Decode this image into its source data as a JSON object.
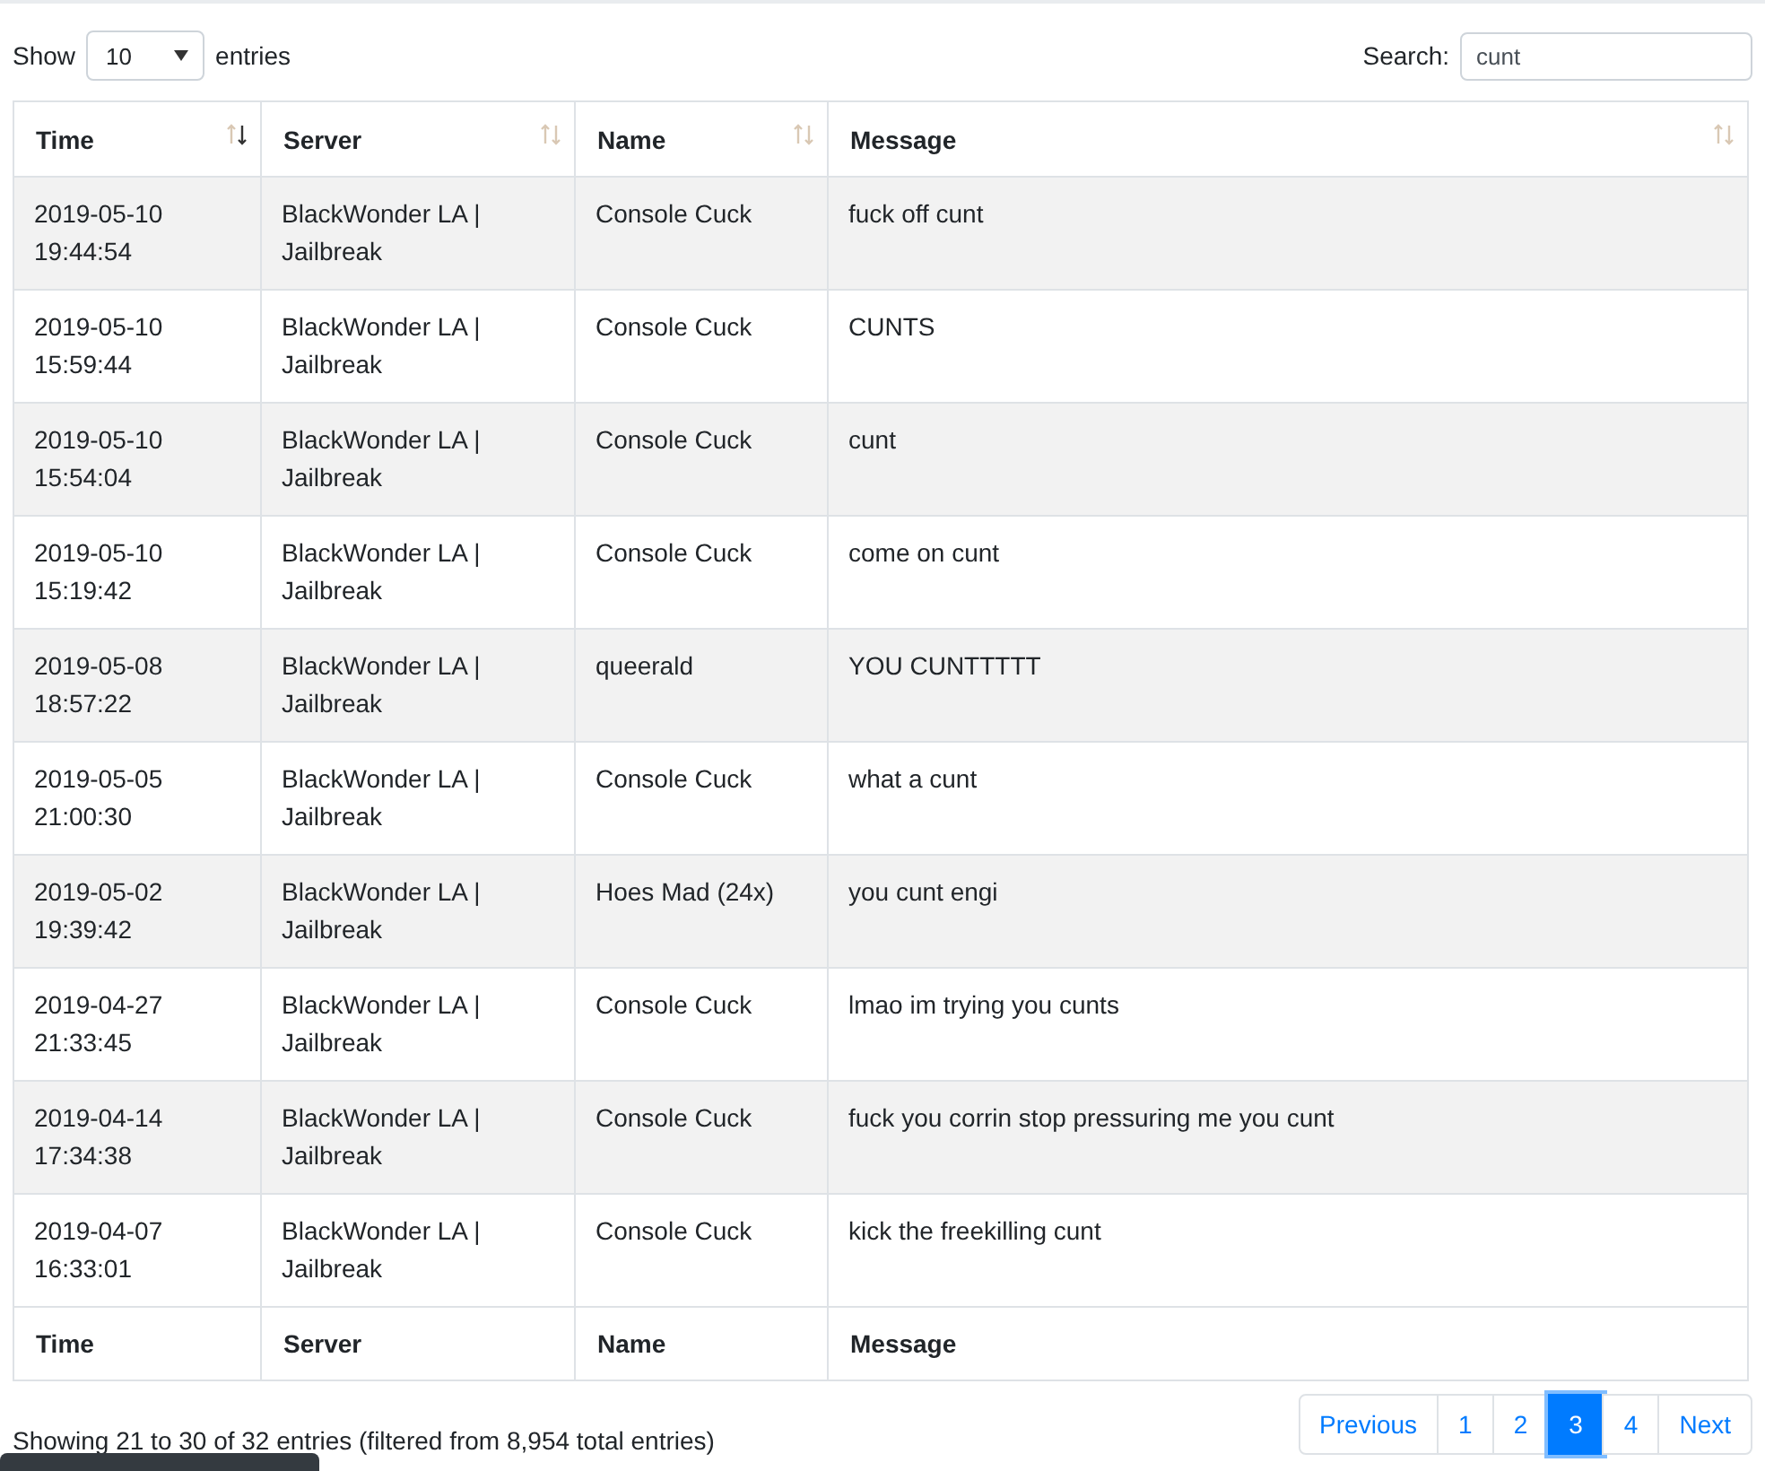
{
  "length_control": {
    "label_before": "Show",
    "value": "10",
    "label_after": "entries"
  },
  "search": {
    "label": "Search:",
    "value": "cunt"
  },
  "table": {
    "columns": [
      {
        "label": "Time",
        "sorted_descending": true
      },
      {
        "label": "Server",
        "sorted_descending": false
      },
      {
        "label": "Name",
        "sorted_descending": false
      },
      {
        "label": "Message",
        "sorted_descending": false
      }
    ],
    "rows": [
      {
        "time": "2019-05-10 19:44:54",
        "server": "BlackWonder LA | Jailbreak",
        "name": "Console Cuck",
        "message": "fuck off cunt"
      },
      {
        "time": "2019-05-10 15:59:44",
        "server": "BlackWonder LA | Jailbreak",
        "name": "Console Cuck",
        "message": "CUNTS"
      },
      {
        "time": "2019-05-10 15:54:04",
        "server": "BlackWonder LA | Jailbreak",
        "name": "Console Cuck",
        "message": "cunt"
      },
      {
        "time": "2019-05-10 15:19:42",
        "server": "BlackWonder LA | Jailbreak",
        "name": "Console Cuck",
        "message": "come on cunt"
      },
      {
        "time": "2019-05-08 18:57:22",
        "server": "BlackWonder LA | Jailbreak",
        "name": "queerald",
        "message": "YOU CUNTTTTT"
      },
      {
        "time": "2019-05-05 21:00:30",
        "server": "BlackWonder LA | Jailbreak",
        "name": "Console Cuck",
        "message": "what a cunt"
      },
      {
        "time": "2019-05-02 19:39:42",
        "server": "BlackWonder LA | Jailbreak",
        "name": "Hoes Mad (24x)",
        "message": "you cunt engi"
      },
      {
        "time": "2019-04-27 21:33:45",
        "server": "BlackWonder LA | Jailbreak",
        "name": "Console Cuck",
        "message": "lmao im trying you cunts"
      },
      {
        "time": "2019-04-14 17:34:38",
        "server": "BlackWonder LA | Jailbreak",
        "name": "Console Cuck",
        "message": "fuck you corrin stop pressuring me you cunt"
      },
      {
        "time": "2019-04-07 16:33:01",
        "server": "BlackWonder LA | Jailbreak",
        "name": "Console Cuck",
        "message": "kick the freekilling cunt"
      }
    ],
    "footer_columns": [
      "Time",
      "Server",
      "Name",
      "Message"
    ]
  },
  "info": "Showing 21 to 30 of 32 entries (filtered from 8,954 total entries)",
  "pagination": [
    {
      "label": "Previous",
      "selected": false
    },
    {
      "label": "1",
      "selected": false
    },
    {
      "label": "2",
      "selected": false
    },
    {
      "label": "3",
      "selected": true
    },
    {
      "label": "4",
      "selected": false
    },
    {
      "label": "Next",
      "selected": false
    }
  ]
}
